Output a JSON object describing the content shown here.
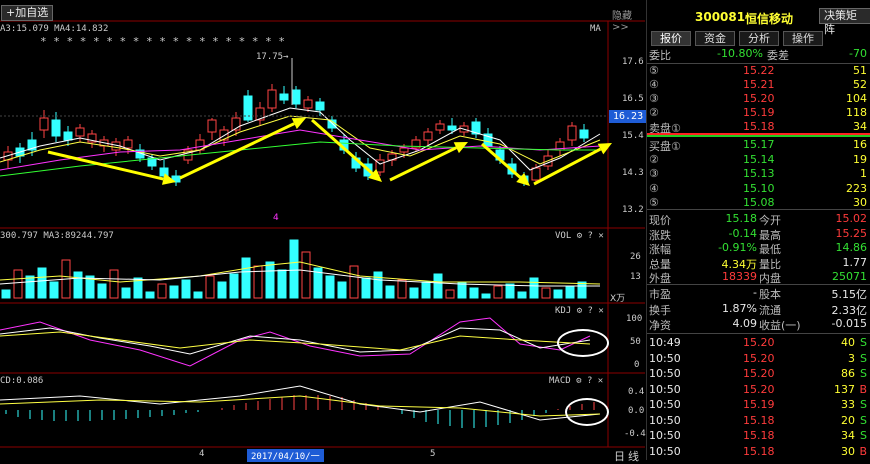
{
  "toolbar": {
    "add_watchlist": "+加自选",
    "hide": "隐藏>>"
  },
  "main_chart": {
    "ma_legend": "A3:15.079  MA4:14.832",
    "ma_right": "MA",
    "stars": "* * * *        * *        *          *             *              *          * * *          * * * * *          *",
    "peak_label": "17.75",
    "current_price": "16.23",
    "y_ticks": [
      "17.6",
      "16.5",
      "15.4",
      "14.3",
      "13.2"
    ],
    "marker": "4"
  },
  "vol_chart": {
    "legend": "300.797  MA3:89244.797",
    "tag": "VOL",
    "y_ticks": [
      "26",
      "13"
    ],
    "unit": "X万"
  },
  "kdj_chart": {
    "tag": "KDJ",
    "y_ticks": [
      "100",
      "50",
      "0"
    ]
  },
  "macd_chart": {
    "legend": "CD:0.086",
    "tag": "MACD",
    "y_ticks": [
      "0.4",
      "0.0",
      "-0.4"
    ]
  },
  "x_axis": {
    "labels": [
      "4",
      "2017/04/10/一",
      "5"
    ],
    "day_label": "日",
    "period_label": "线"
  },
  "stock": {
    "code": "300081",
    "name": "恒信移动",
    "decision_btn": "决策矩阵"
  },
  "tabs": [
    "报价",
    "资金",
    "分析",
    "操作"
  ],
  "ratio": {
    "label": "委比",
    "value": "-10.80%",
    "diff_label": "委差",
    "diff": "-70"
  },
  "sell_orders": [
    {
      "level": "⑤",
      "price": "15.22",
      "vol": "51"
    },
    {
      "level": "④",
      "price": "15.21",
      "vol": "52"
    },
    {
      "level": "③",
      "price": "15.20",
      "vol": "104"
    },
    {
      "level": "②",
      "price": "15.19",
      "vol": "118"
    },
    {
      "level": "卖盘①",
      "price": "15.18",
      "vol": "34"
    }
  ],
  "buy_orders": [
    {
      "level": "买盘①",
      "price": "15.17",
      "vol": "16"
    },
    {
      "level": "②",
      "price": "15.14",
      "vol": "19"
    },
    {
      "level": "③",
      "price": "15.13",
      "vol": "1"
    },
    {
      "level": "④",
      "price": "15.10",
      "vol": "223"
    },
    {
      "level": "⑤",
      "price": "15.08",
      "vol": "30"
    }
  ],
  "quote": [
    {
      "l1": "现价",
      "v1": "15.18",
      "l2": "今开",
      "v2": "15.02"
    },
    {
      "l1": "涨跌",
      "v1": "-0.14",
      "l2": "最高",
      "v2": "15.25"
    },
    {
      "l1": "涨幅",
      "v1": "-0.91%",
      "l2": "最低",
      "v2": "14.86"
    },
    {
      "l1": "总量",
      "v1": "4.34万",
      "l2": "量比",
      "v2": "1.77"
    },
    {
      "l1": "外盘",
      "v1": "18339",
      "l2": "内盘",
      "v2": "25071"
    }
  ],
  "fundamentals": [
    {
      "l1": "市盈",
      "v1": "-",
      "l2": "股本",
      "v2": "5.15亿"
    },
    {
      "l1": "换手",
      "v1": "1.87%",
      "l2": "流通",
      "v2": "2.33亿"
    },
    {
      "l1": "净资",
      "v1": "4.09",
      "l2": "收益(一)",
      "v2": "-0.015"
    }
  ],
  "ticks": [
    {
      "time": "10:49",
      "price": "15.20",
      "vol": "40",
      "side": "S"
    },
    {
      "time": "10:50",
      "price": "15.20",
      "vol": "3",
      "side": "S"
    },
    {
      "time": "10:50",
      "price": "15.20",
      "vol": "86",
      "side": "S"
    },
    {
      "time": "10:50",
      "price": "15.20",
      "vol": "137",
      "side": "B"
    },
    {
      "time": "10:50",
      "price": "15.19",
      "vol": "33",
      "side": "S"
    },
    {
      "time": "10:50",
      "price": "15.18",
      "vol": "20",
      "side": "S"
    },
    {
      "time": "10:50",
      "price": "15.18",
      "vol": "34",
      "side": "S"
    },
    {
      "time": "10:50",
      "price": "15.18",
      "vol": "30",
      "side": "B"
    }
  ]
}
